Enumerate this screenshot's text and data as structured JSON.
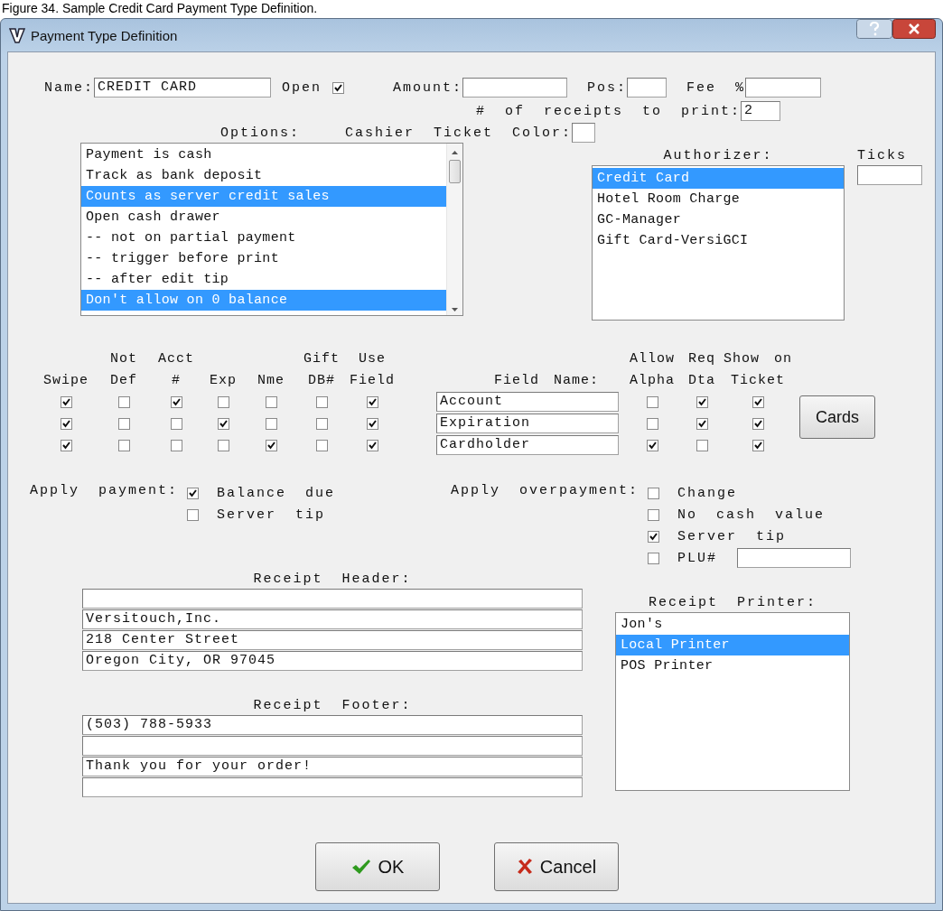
{
  "caption": "Figure 34.  Sample Credit Card Payment Type Definition.",
  "window": {
    "title": "Payment Type Definition"
  },
  "name": {
    "label": "Name:",
    "value": "CREDIT CARD"
  },
  "open": {
    "label": "Open",
    "checked": true
  },
  "amount": {
    "label": "Amount:"
  },
  "pos": {
    "label": "Pos:"
  },
  "fee": {
    "label": "Fee %"
  },
  "receipts_to_print": {
    "label": "# of receipts to print:",
    "value": "2"
  },
  "cashier_ticket_color": {
    "label": "Cashier Ticket Color:"
  },
  "options": {
    "label": "Options:",
    "items": [
      {
        "text": "Payment is cash",
        "selected": false
      },
      {
        "text": "Track as bank deposit",
        "selected": false
      },
      {
        "text": "Counts as server credit sales",
        "selected": true
      },
      {
        "text": "Open cash drawer",
        "selected": false
      },
      {
        "text": "-- not on partial payment",
        "selected": false
      },
      {
        "text": "-- trigger before print",
        "selected": false
      },
      {
        "text": "-- after edit tip",
        "selected": false
      },
      {
        "text": "Don't allow on 0 balance",
        "selected": true
      }
    ]
  },
  "authorizer": {
    "label": "Authorizer:",
    "items": [
      {
        "text": "Credit Card",
        "selected": true
      },
      {
        "text": "Hotel Room Charge",
        "selected": false
      },
      {
        "text": "GC-Manager",
        "selected": false
      },
      {
        "text": "Gift Card-VersiGCI",
        "selected": false
      }
    ]
  },
  "ticks": {
    "label": "Ticks"
  },
  "field_grid": {
    "left_columns": [
      {
        "bottom": "Swipe"
      },
      {
        "top": "Not",
        "bottom": "Def"
      },
      {
        "top": "Acct",
        "bottom": "#"
      },
      {
        "bottom": "Exp"
      },
      {
        "bottom": "Nme"
      },
      {
        "top": "Gift",
        "bottom": "DB#"
      },
      {
        "top": "Use",
        "bottom": "Field"
      }
    ],
    "field_column": {
      "bottom": "Field Name:"
    },
    "right_columns": [
      {
        "top": "Allow",
        "bottom": "Alpha"
      },
      {
        "top": "Req",
        "bottom": "Dta"
      },
      {
        "top": "Show on",
        "bottom": "Ticket"
      }
    ],
    "rows": [
      {
        "left": [
          true,
          false,
          true,
          false,
          false,
          false,
          true
        ],
        "field_name": "Account",
        "right": [
          false,
          true,
          true
        ]
      },
      {
        "left": [
          true,
          false,
          false,
          true,
          false,
          false,
          true
        ],
        "field_name": "Expiration",
        "right": [
          false,
          true,
          true
        ]
      },
      {
        "left": [
          true,
          false,
          false,
          false,
          true,
          false,
          true
        ],
        "field_name": "Cardholder",
        "right": [
          true,
          false,
          true
        ]
      }
    ]
  },
  "cards_button": "Cards",
  "apply_payment": {
    "label": "Apply payment:",
    "options": [
      {
        "label": "Balance due",
        "checked": true
      },
      {
        "label": "Server tip",
        "checked": false
      }
    ]
  },
  "apply_overpayment": {
    "label": "Apply overpayment:",
    "options": [
      {
        "label": "Change",
        "checked": false,
        "kind": "check"
      },
      {
        "label": "No cash value",
        "checked": false,
        "kind": "check"
      },
      {
        "label": "Server tip",
        "checked": true,
        "kind": "check"
      },
      {
        "label": "PLU#",
        "checked": false,
        "kind": "check_field"
      }
    ]
  },
  "receipt_header": {
    "label": "Receipt Header:",
    "lines": [
      {
        "kind": "blank"
      },
      {
        "kind": "text",
        "value": "Versitouch,Inc."
      },
      {
        "kind": "text",
        "value": "218 Center Street"
      },
      {
        "kind": "text",
        "value": "Oregon City, OR 97045"
      }
    ]
  },
  "receipt_footer": {
    "label": "Receipt Footer:",
    "lines": [
      {
        "kind": "text",
        "value": "(503) 788-5933"
      },
      {
        "kind": "blank"
      },
      {
        "kind": "text",
        "value": "Thank you for your order!"
      },
      {
        "kind": "blank"
      }
    ]
  },
  "receipt_printer": {
    "label": "Receipt Printer:",
    "items": [
      {
        "text": "Jon's",
        "selected": false
      },
      {
        "text": "Local Printer",
        "selected": true
      },
      {
        "text": "POS Printer",
        "selected": false
      }
    ]
  },
  "buttons": [
    {
      "label": "OK",
      "kind": "ok"
    },
    {
      "label": "Cancel",
      "kind": "cancel"
    }
  ]
}
